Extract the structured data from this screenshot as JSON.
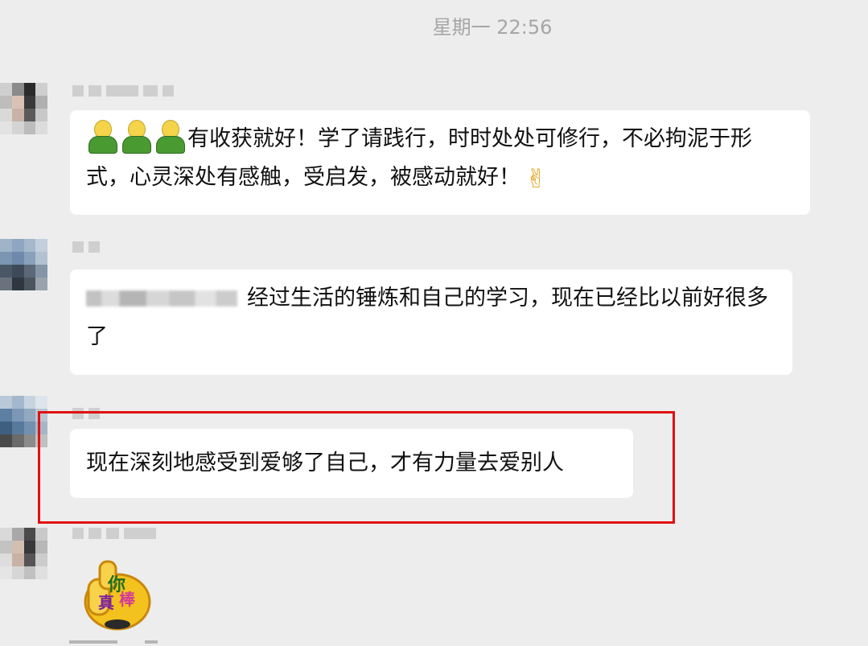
{
  "chat": {
    "timestamp": "星期一 22:56",
    "messages": [
      {
        "lead_stickers": [
          "person-sticker-icon",
          "person-sticker-icon",
          "person-sticker-icon"
        ],
        "text": "有收获就好！学了请践行，时时处处可修行，不必拘泥于形式，心灵深处有感触，受启发，被感动就好！",
        "trail_icon": "victory-hand-icon",
        "trail_glyph": "✌"
      },
      {
        "mention_blurred": true,
        "text": "经过生活的锤炼和自己的学习，现在已经比以前好很多了"
      },
      {
        "text": "现在深刻地感受到爱够了自己，才有力量去爱别人",
        "highlighted": true
      },
      {
        "sticker": "thumbs-up-sticker-icon",
        "sticker_text": "你真棒"
      }
    ]
  },
  "colors": {
    "background": "#ededed",
    "bubble": "#ffffff",
    "highlight_border": "#e01010",
    "timestamp": "#a6a6a6"
  }
}
